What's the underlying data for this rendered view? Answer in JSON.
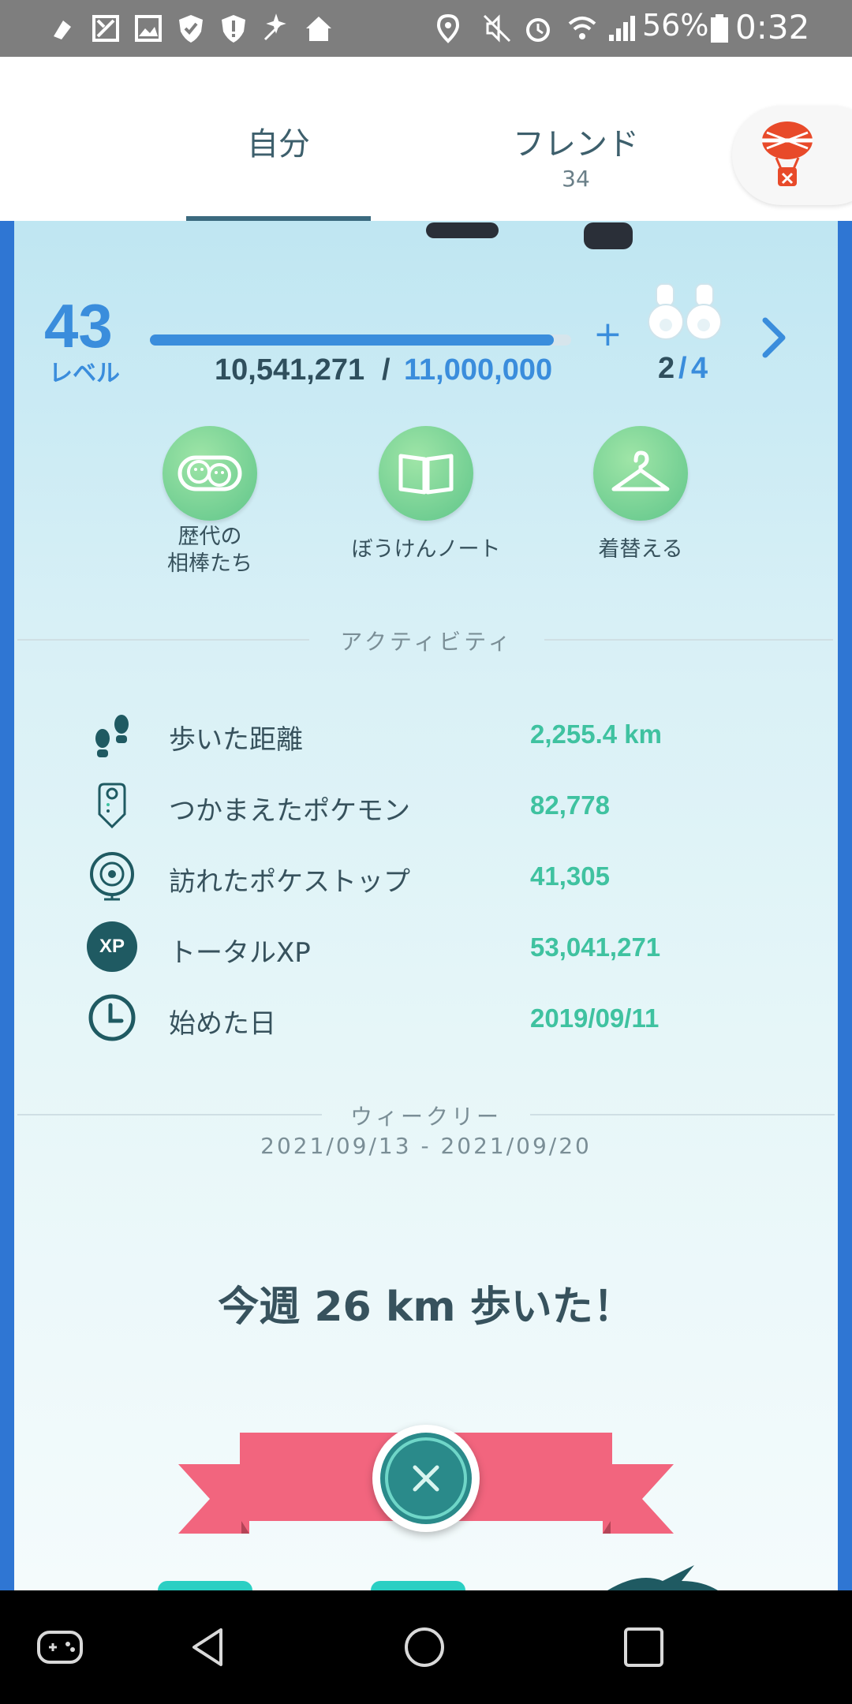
{
  "status_bar": {
    "icons": [
      "usb-debug-icon",
      "image-x-icon",
      "gallery-icon",
      "shield-check-icon",
      "shield-alert-icon",
      "sparkle-icon",
      "home-icon",
      "location-icon",
      "mute-icon",
      "alarm-icon",
      "wifi-icon",
      "signal-icon",
      "battery-icon"
    ],
    "battery": "56%",
    "time": "0:32"
  },
  "tabs": {
    "self": "自分",
    "friends": "フレンド",
    "friends_count": "34"
  },
  "profile": {
    "level": "43",
    "level_label": "レベル",
    "xp_current": "10,541,271",
    "xp_slash": "/",
    "xp_max": "11,000,000",
    "xp_progress": 0.958,
    "plus": "+",
    "binoculars_current": "2",
    "binoculars_sep": "/",
    "binoculars_total": "4"
  },
  "buttons": {
    "buddies_line1": "歴代の",
    "buddies_line2": "相棒たち",
    "journal": "ぼうけんノート",
    "style": "着替える"
  },
  "activity": {
    "title": "アクティビティ",
    "rows": [
      {
        "label": "歩いた距離",
        "value": "2,255.4 km"
      },
      {
        "label": "つかまえたポケモン",
        "value": "82,778"
      },
      {
        "label": "訪れたポケストップ",
        "value": "41,305"
      },
      {
        "label": "トータルXP",
        "value": "53,041,271"
      },
      {
        "label": "始めた日",
        "value": "2019/09/11"
      }
    ]
  },
  "weekly": {
    "title": "ウィークリー",
    "range": "2021/09/13 - 2021/09/20",
    "headline": "今週 26 km 歩いた！"
  },
  "xp_icon_label": "XP",
  "colors": {
    "accent_blue": "#3a8ddc",
    "stat_green": "#3fc2a0",
    "ribbon_pink": "#f2657e",
    "teal_dark": "#1f5a62"
  }
}
